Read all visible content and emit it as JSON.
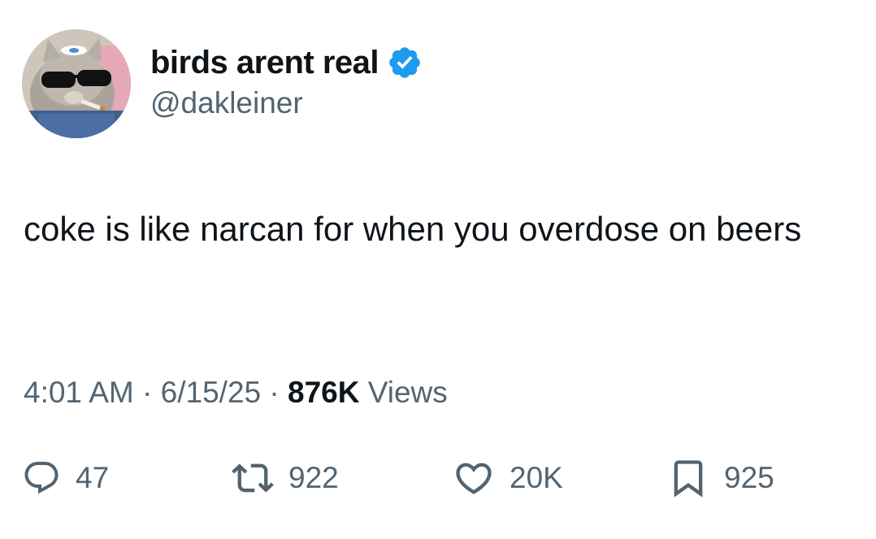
{
  "author": {
    "display_name": "birds arent real",
    "handle": "@dakleiner",
    "verified_badge_icon": "verified-badge-icon",
    "verified_color": "#1d9bf0"
  },
  "tweet": {
    "text": "coke is like narcan for when you overdose on beers"
  },
  "meta": {
    "time": "4:01 AM",
    "separator": "·",
    "date": "6/15/25",
    "views_count": "876K",
    "views_label": "Views"
  },
  "actions": {
    "replies": {
      "icon": "reply-icon",
      "count": "47"
    },
    "reposts": {
      "icon": "repost-icon",
      "count": "922"
    },
    "likes": {
      "icon": "heart-icon",
      "count": "20K"
    },
    "bookmarks": {
      "icon": "bookmark-icon",
      "count": "925"
    }
  },
  "colors": {
    "text_primary": "#0f1419",
    "text_secondary": "#536471",
    "background": "#ffffff"
  }
}
